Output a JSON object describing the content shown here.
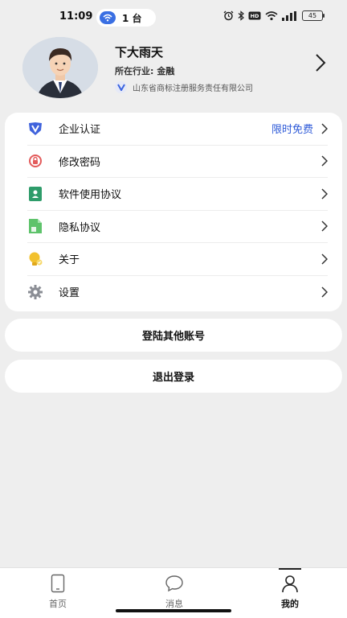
{
  "status": {
    "time": "11:09",
    "hotspot_label": "1 台",
    "battery": "45"
  },
  "profile": {
    "name": "下大雨天",
    "industry_label": "所在行业:",
    "industry_value": "金融",
    "company": "山东省商标注册服务责任有限公司"
  },
  "menu": {
    "items": [
      {
        "label": "企业认证",
        "extra": "限时免费"
      },
      {
        "label": "修改密码"
      },
      {
        "label": "软件使用协议"
      },
      {
        "label": "隐私协议"
      },
      {
        "label": "关于"
      },
      {
        "label": "设置"
      }
    ]
  },
  "actions": {
    "switch_account": "登陆其他账号",
    "logout": "退出登录"
  },
  "tabbar": {
    "home": "首页",
    "messages": "消息",
    "me": "我的"
  },
  "colors": {
    "accent": "#2f5bd8",
    "page_bg": "#eeeeee"
  }
}
